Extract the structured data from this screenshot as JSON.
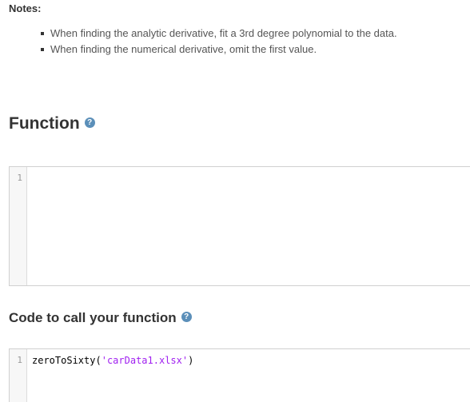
{
  "notes": {
    "label": "Notes:",
    "items": [
      "When finding the analytic derivative, fit a 3rd degree polynomial to the data.",
      "When finding the numerical derivative, omit the first value."
    ]
  },
  "function_section": {
    "heading": "Function",
    "help_icon": "question-circle-icon",
    "help_glyph": "?",
    "editor": {
      "line_numbers": [
        "1"
      ],
      "code": ""
    }
  },
  "call_section": {
    "heading": "Code to call your function",
    "help_icon": "question-circle-icon",
    "help_glyph": "?",
    "editor": {
      "line_numbers": [
        "1"
      ],
      "code_fn": "zeroToSixty",
      "code_open": "(",
      "code_string": "'carData1.xlsx'",
      "code_close": ")"
    }
  },
  "colors": {
    "help_icon": "#5b8fb9",
    "string_literal": "#a020f0",
    "gutter": "#f7f7f7"
  }
}
